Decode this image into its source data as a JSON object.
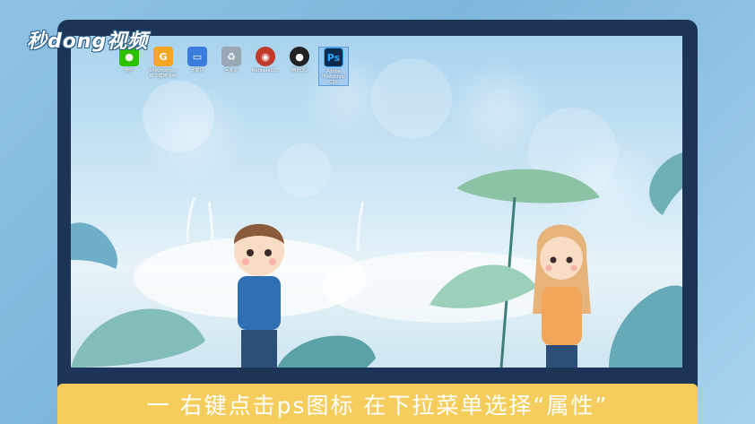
{
  "watermark": "秒dong视频",
  "desktop_icons": [
    {
      "name": "wechat",
      "label": "微信",
      "icon": "wechat-icon",
      "color": "#2dc100",
      "glyph": "💬"
    },
    {
      "name": "gdmath",
      "label": "GMKmathe...\n练习模板.exe",
      "icon": "g-app-icon",
      "color": "#f5a623",
      "glyph": "G"
    },
    {
      "name": "computer",
      "label": "计算机",
      "icon": "computer-icon",
      "color": "#3b7ddd",
      "glyph": "▭"
    },
    {
      "name": "recycle-bin",
      "label": "回收站",
      "icon": "recycle-bin-icon",
      "color": "#9aa7b5",
      "glyph": "♻"
    },
    {
      "name": "netease",
      "label": "NeteaseCl...",
      "icon": "music-icon",
      "color": "#c0392b",
      "glyph": "◉"
    },
    {
      "name": "qq",
      "label": "腾讯QQ",
      "icon": "qq-penguin-icon",
      "color": "#222222",
      "glyph": "🐧"
    },
    {
      "name": "photoshop",
      "label": "Adobe\nPhotoshop\nCS6",
      "icon": "photoshop-icon",
      "color": "#0b2b4d",
      "glyph": "Ps",
      "selected": true
    }
  ],
  "caption": "一  右键点击ps图标  在下拉菜单选择“属性”",
  "colors": {
    "monitor_frame": "#1c3557",
    "caption_bar": "#f4cd5c",
    "background": "#8fc3e4"
  }
}
